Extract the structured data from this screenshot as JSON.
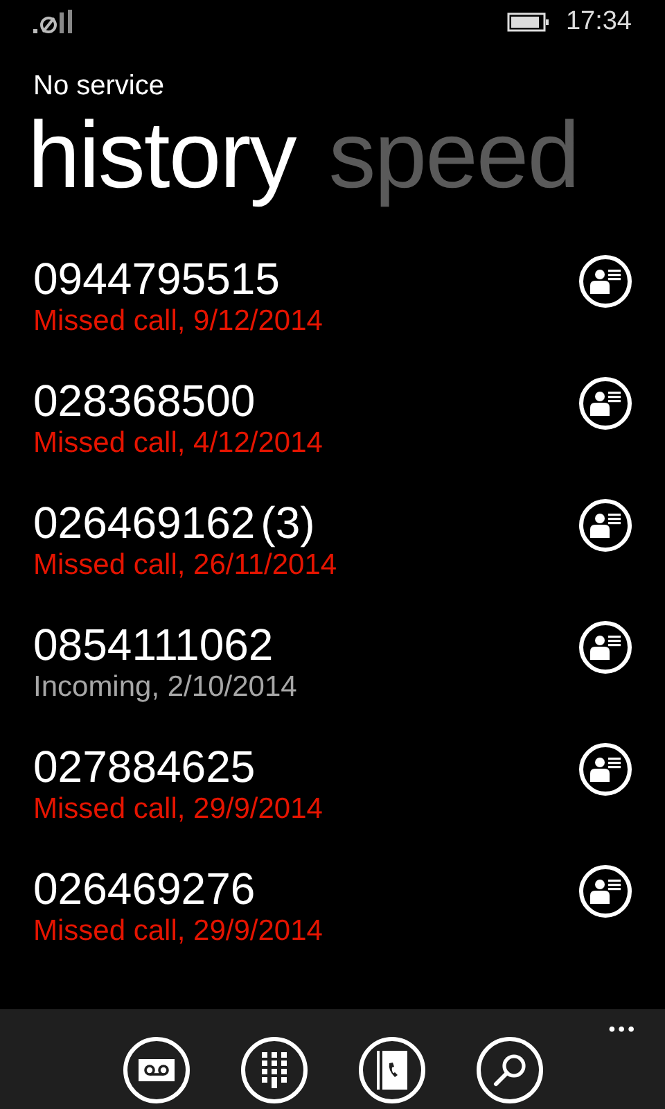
{
  "status_bar": {
    "time": "17:34"
  },
  "title": "No service",
  "pivots": [
    {
      "label": "history",
      "selected": true
    },
    {
      "label": "speed",
      "selected": false
    }
  ],
  "calls": [
    {
      "number": "0944795515",
      "detail": "Missed call, 9/12/2014",
      "kind": "missed"
    },
    {
      "number": "028368500",
      "detail": "Missed call, 4/12/2014",
      "kind": "missed"
    },
    {
      "number": "026469162",
      "count": "(3)",
      "detail": "Missed call, 26/11/2014",
      "kind": "missed"
    },
    {
      "number": "0854111062",
      "detail": "Incoming, 2/10/2014",
      "kind": "incoming"
    },
    {
      "number": "027884625",
      "detail": "Missed call, 29/9/2014",
      "kind": "missed"
    },
    {
      "number": "026469276",
      "detail": "Missed call, 29/9/2014",
      "kind": "missed"
    }
  ],
  "app_bar": {
    "more": "•••"
  }
}
